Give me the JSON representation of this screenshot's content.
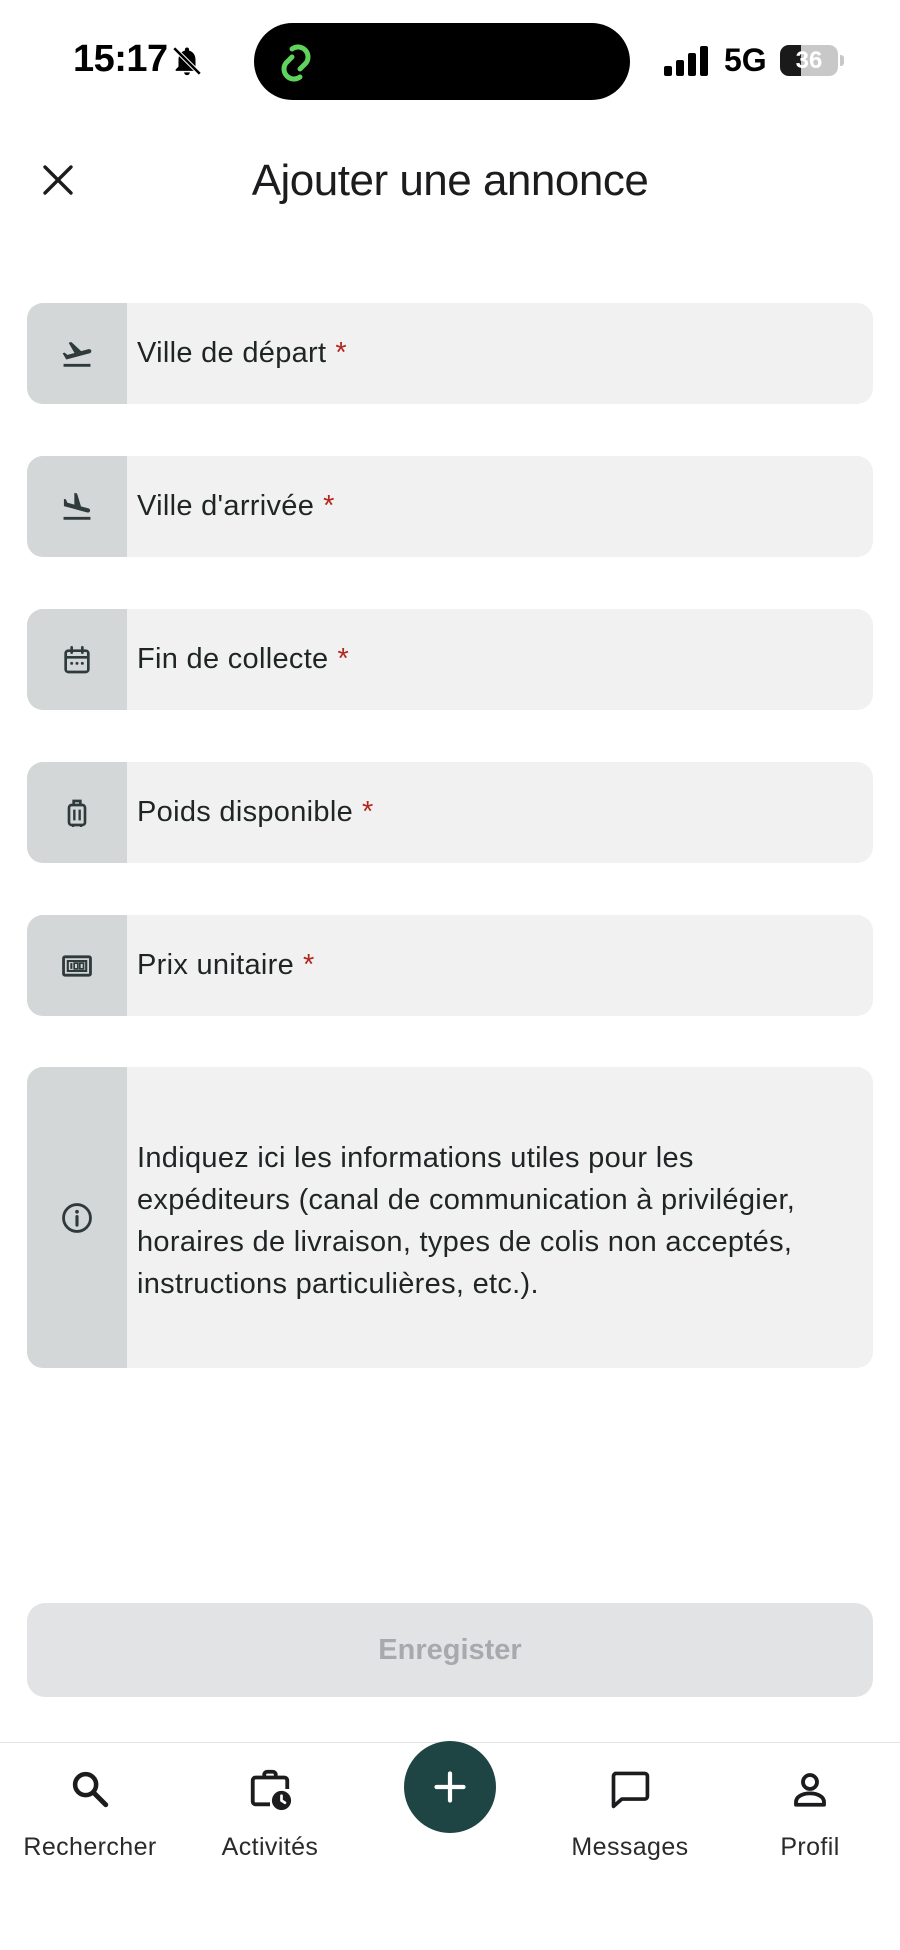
{
  "status_bar": {
    "time": "15:17",
    "network": "5G",
    "battery_level": "36",
    "battery_fraction": 0.36
  },
  "header": {
    "title": "Ajouter une annonce"
  },
  "form": {
    "required_mark": "*",
    "fields": [
      {
        "label": "Ville de départ",
        "icon": "flight-takeoff-icon"
      },
      {
        "label": "Ville d'arrivée",
        "icon": "flight-land-icon"
      },
      {
        "label": "Fin de collecte",
        "icon": "calendar-icon"
      },
      {
        "label": "Poids disponible",
        "icon": "luggage-icon"
      },
      {
        "label": "Prix unitaire",
        "icon": "price-icon"
      }
    ],
    "notes": {
      "placeholder": "Indiquez ici les informations utiles pour les expéditeurs (canal de communication à privilégier, horaires de livraison, types de colis non acceptés, instructions particulières, etc.).",
      "icon": "info-icon"
    }
  },
  "actions": {
    "save_label": "Enregister"
  },
  "bottom_nav": {
    "items": [
      {
        "label": "Rechercher",
        "icon": "search-icon"
      },
      {
        "label": "Activités",
        "icon": "activities-icon"
      },
      {
        "label": "",
        "icon": "add-icon"
      },
      {
        "label": "Messages",
        "icon": "message-icon"
      },
      {
        "label": "Profil",
        "icon": "profile-icon"
      }
    ]
  },
  "colors": {
    "accent": "#1f4444",
    "field_bg": "#f1f1f1",
    "icon_bg": "#d3d7d7",
    "required": "#b3261e",
    "disabled_button": "#e2e3e5"
  }
}
